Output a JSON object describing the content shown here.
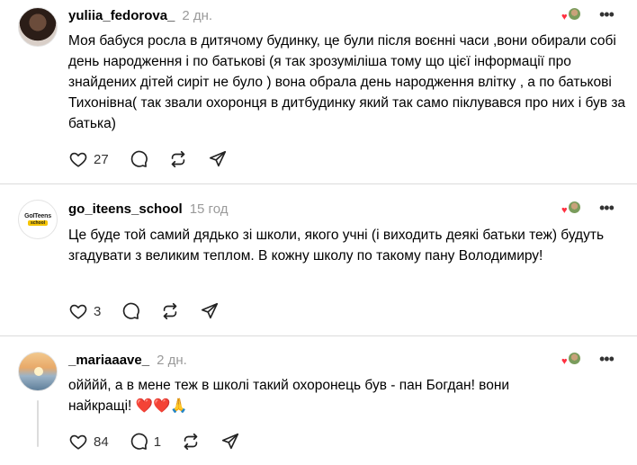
{
  "comments": [
    {
      "username": "yuliia_fedorova_",
      "time": "2 дн.",
      "text": "Моя бабуся росла в дитячому будинку, це були після воєнні часи ,вони обирали собі день народження і по батькові (я так зрозуміліша тому що цієї інформації про знайдених дітей сиріт не було ) вона обрала день народження влітку , а по батькові Тихонівна( так звали охоронця в дитбудинку який так само піклувався про них і був за батька)",
      "likes": "27",
      "replies": ""
    },
    {
      "username": "go_iteens_school",
      "time": "15 год",
      "text": "Це буде той самий дядько зі школи, якого учні (і виходить деякі батьки теж) будуть згадувати з великим теплом. В кожну школу по такому пану Володимиру!",
      "likes": "3",
      "replies": "",
      "avatar_logo_top": "GoITeens",
      "avatar_logo_bottom": "school"
    },
    {
      "username": "_mariaaave_",
      "time": "2 дн.",
      "text": "ойййй, а в мене теж в школі такий охоронець був - пан Богдан! вони найкращі!",
      "emoji": "❤️❤️🙏",
      "likes": "84",
      "replies": "1"
    }
  ],
  "icons": {
    "like": "heart-icon",
    "reply": "speech-bubble-icon",
    "repost": "repost-icon",
    "share": "send-icon",
    "more": "more-dots-icon"
  },
  "colors": {
    "accent_heart": "#ff3040",
    "muted_text": "#9a9a9a",
    "separator": "#dcdcdc"
  }
}
